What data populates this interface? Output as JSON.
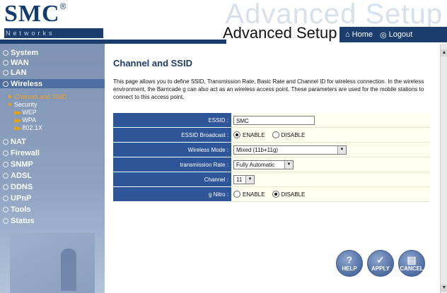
{
  "header": {
    "logo_text": "SMC",
    "logo_reg": "®",
    "logo_sub": "Networks",
    "watermark": "Advanced Setup",
    "title": "Advanced Setup",
    "nav": [
      {
        "label": "Home",
        "icon": "home-icon"
      },
      {
        "label": "Logout",
        "icon": "logout-icon"
      }
    ]
  },
  "sidebar": {
    "items": [
      {
        "label": "System"
      },
      {
        "label": "WAN"
      },
      {
        "label": "LAN"
      },
      {
        "label": "Wireless"
      },
      {
        "label": "NAT"
      },
      {
        "label": "Firewall"
      },
      {
        "label": "SNMP"
      },
      {
        "label": "ADSL"
      },
      {
        "label": "DDNS"
      },
      {
        "label": "UPnP"
      },
      {
        "label": "Tools"
      },
      {
        "label": "Status"
      }
    ],
    "wireless_sub": [
      {
        "label": "Channel and SSID"
      },
      {
        "label": "Security"
      }
    ],
    "security_sub": [
      {
        "label": "WEP"
      },
      {
        "label": "WPA"
      },
      {
        "label": "802.1X"
      }
    ]
  },
  "main": {
    "title": "Channel and SSID",
    "description": "This page allows you to define SSID, Transmission Rate, Basic Rate and Channel ID for wireless connection. In the wireless environment, the Barricade g can also act as an wireless access point. These parameters are used for the mobile stations to connect to this access point.",
    "fields": {
      "essid": {
        "label": "ESSID",
        "value": "SMC"
      },
      "broadcast": {
        "label": "ESSID Broadcast",
        "options": [
          "ENABLE",
          "DISABLE"
        ],
        "selected": "ENABLE"
      },
      "mode": {
        "label": "Wireless Mode",
        "value": "Mixed (11b+11g)"
      },
      "rate": {
        "label": "transmission Rate",
        "value": "Fully Automatic"
      },
      "channel": {
        "label": "Channel",
        "value": "11"
      },
      "nitro": {
        "label": "g Nitro",
        "options": [
          "ENABLE",
          "DISABLE"
        ],
        "selected": "DISABLE"
      }
    },
    "buttons": {
      "help": "HELP",
      "apply": "APPLY",
      "cancel": "CANCEL"
    }
  },
  "colors": {
    "accent": "#2e5597",
    "brand": "#1b3e6f",
    "sidebar": "#8ea2c0"
  }
}
